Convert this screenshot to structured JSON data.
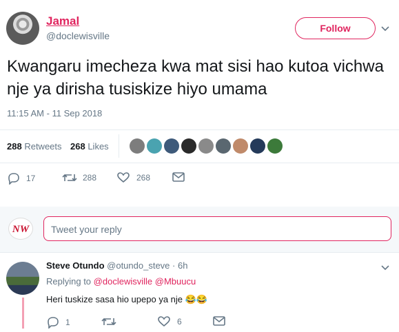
{
  "tweet": {
    "author_name": "Jamal",
    "author_handle": "@doclewisville",
    "follow_label": "Follow",
    "text": "Kwangaru imecheza kwa mat sisi hao kutoa vichwa nje ya dirisha tusiskize hiyo umama",
    "timestamp": "11:15 AM - 11 Sep 2018",
    "retweets_count": "288",
    "retweets_label": "Retweets",
    "likes_count": "268",
    "likes_label": "Likes",
    "reply_count": "17",
    "retweet_count": "288",
    "like_count": "268",
    "liker_avatars": 9
  },
  "composer": {
    "placeholder": "Tweet your reply",
    "logo_text": "NW"
  },
  "reply": {
    "author_name": "Steve Otundo",
    "author_handle": "@otundo_steve",
    "time": "· 6h",
    "replying_prefix": "Replying to",
    "mention_1": "@doclewisville",
    "mention_2": "@Mbuucu",
    "text": "Heri tuskize sasa hio upepo ya nje",
    "emoji": "😂😂",
    "reply_count": "1",
    "retweet_count": "",
    "like_count": "6"
  },
  "colors": {
    "accent": "#e0245e",
    "secondary_text": "#657786",
    "divider": "#e6ecf0"
  }
}
